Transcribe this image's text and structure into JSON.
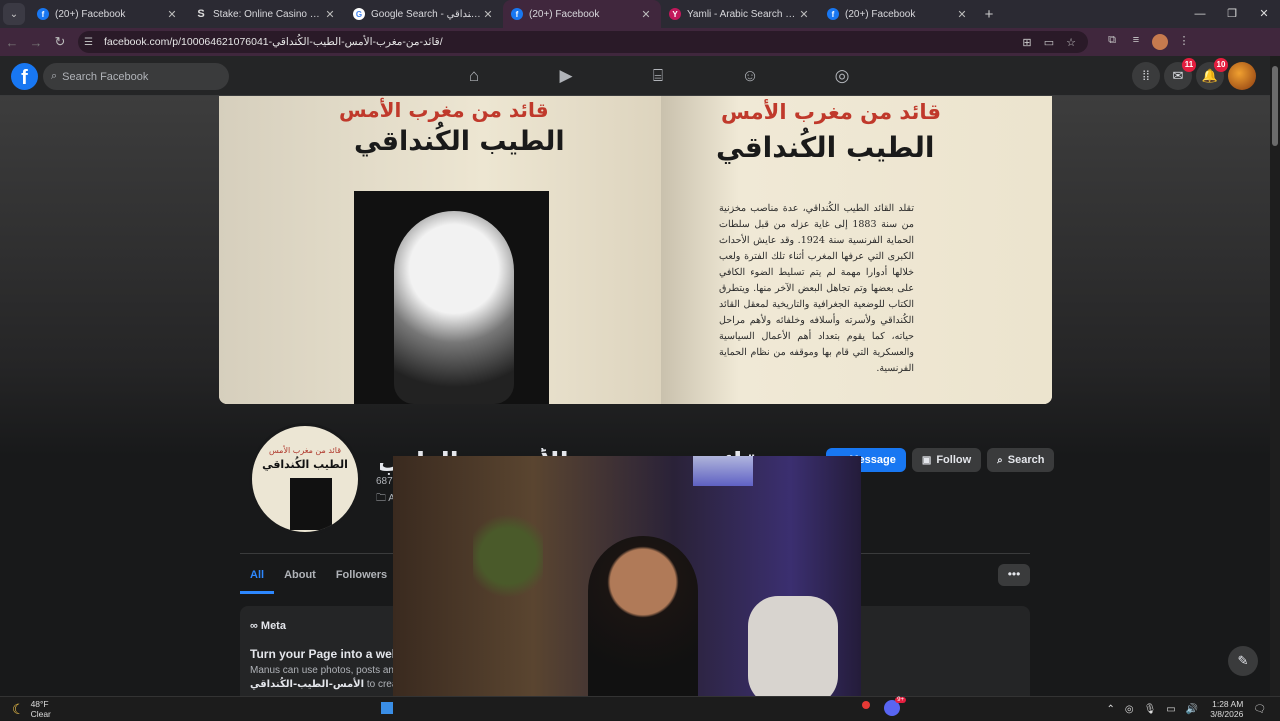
{
  "browser": {
    "tabs": [
      {
        "label": "(20+) Facebook",
        "icon": "facebook-icon"
      },
      {
        "label": "Stake: Online Casino & Sports",
        "icon": "stake-icon"
      },
      {
        "label": "Google Search - لقايد لقنداقي",
        "icon": "google-icon"
      },
      {
        "label": "(20+) Facebook",
        "icon": "facebook-icon",
        "active": true
      },
      {
        "label": "Yamli - Arabic Search Engine an",
        "icon": "yamli-icon"
      },
      {
        "label": "(20+) Facebook",
        "icon": "facebook-icon"
      }
    ],
    "url": "facebook.com/p/قائد-من-مغرب-الأمس-الطيب-الكُنداقي-100064621076041/"
  },
  "fb": {
    "search_placeholder": "Search Facebook",
    "messenger_badge": "11",
    "notifications_badge": "10"
  },
  "cover": {
    "left_red": "قائد من مغرب الأمس",
    "left_black": "الطيب الكُنداقي",
    "right_red": "قائد من مغرب الأمس",
    "right_black": "الطيب الكُنداقي",
    "paragraph": "تقلد القائد الطيب الكُنداقي، عدة مناصب مخزنية من سنة 1883 إلى غاية عزله من قبل سلطات الحماية الفرنسية سنة 1924. وقد عايش الأحداث الكبرى التي عرفها المغرب أثناء تلك الفترة ولعب خلالها أدوارا مهمة لم يتم تسليط الضوء الكافي على بعضها وتم تجاهل البعض الآخر منها. ويتطرق الكتاب للوضعية الجغرافية والتاريخية لمعقل القائد الكُنداقي ولأسرته وأسلافه وخلفائه ولأهم مراحل حياته، كما يقوم بتعداد أهم الأعمال السياسية والعسكرية التي قام بها وموقفه من نظام الحماية الفرنسية."
  },
  "profile": {
    "pic_line1": "قائد من مغرب الأمس",
    "pic_line2": "الطيب الكُنداقي",
    "name": "قائد من مغرب الأمس - الطيب الكُنداقي",
    "followers": "687",
    "category": "A",
    "actions": {
      "message": "Message",
      "follow": "Follow",
      "search": "Search"
    }
  },
  "page_tabs": [
    {
      "label": "All",
      "active": true
    },
    {
      "label": "About"
    },
    {
      "label": "Followers"
    }
  ],
  "card": {
    "meta": "Meta",
    "title": "Turn your Page into a websi",
    "sub": "Manus can use photos, posts an",
    "sub2_name": "الأمس-الطيب-الكُنداقي",
    "sub2_rest": " to create a"
  },
  "taskbar": {
    "temp": "48°F",
    "condition": "Clear",
    "time": "1:28 AM",
    "date": "3/8/2026",
    "discord_badge": "9+"
  }
}
